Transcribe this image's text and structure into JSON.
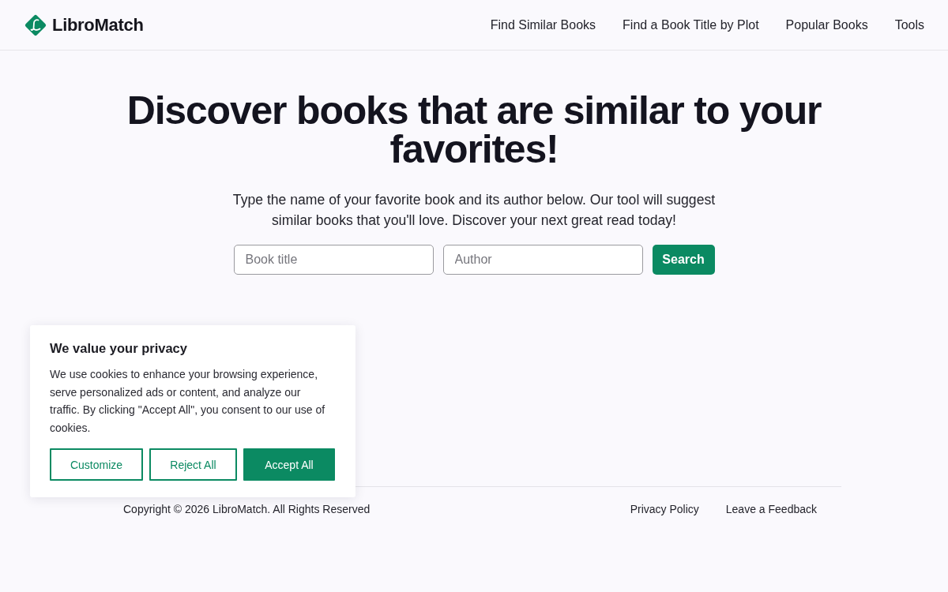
{
  "header": {
    "logo": "LibroMatch",
    "nav": [
      "Find Similar Books",
      "Find a Book Title by Plot",
      "Popular Books",
      "Tools"
    ]
  },
  "hero": {
    "title": "Discover books that are similar to your favorites!",
    "description": "Type the name of your favorite book and its author below. Our tool will suggest similar books that you'll love. Discover your next great read today!"
  },
  "search": {
    "fields": [
      {
        "placeholder": "Book title"
      },
      {
        "placeholder": "Author"
      }
    ],
    "button": "Search"
  },
  "footer": {
    "copyright": "Copyright © 2026 LibroMatch. All Rights Reserved",
    "links": [
      "Privacy Policy",
      "Leave a Feedback"
    ]
  },
  "cookie_banner": {
    "title": "We value your privacy",
    "text": "We use cookies to enhance your browsing experience, serve personalized ads or content, and analyze our traffic. By clicking \"Accept All\", you consent to our use of cookies.",
    "buttons": [
      {
        "label": "Customize",
        "kind": "outline"
      },
      {
        "label": "Reject All",
        "kind": "outline"
      },
      {
        "label": "Accept All",
        "kind": "primary"
      }
    ]
  }
}
